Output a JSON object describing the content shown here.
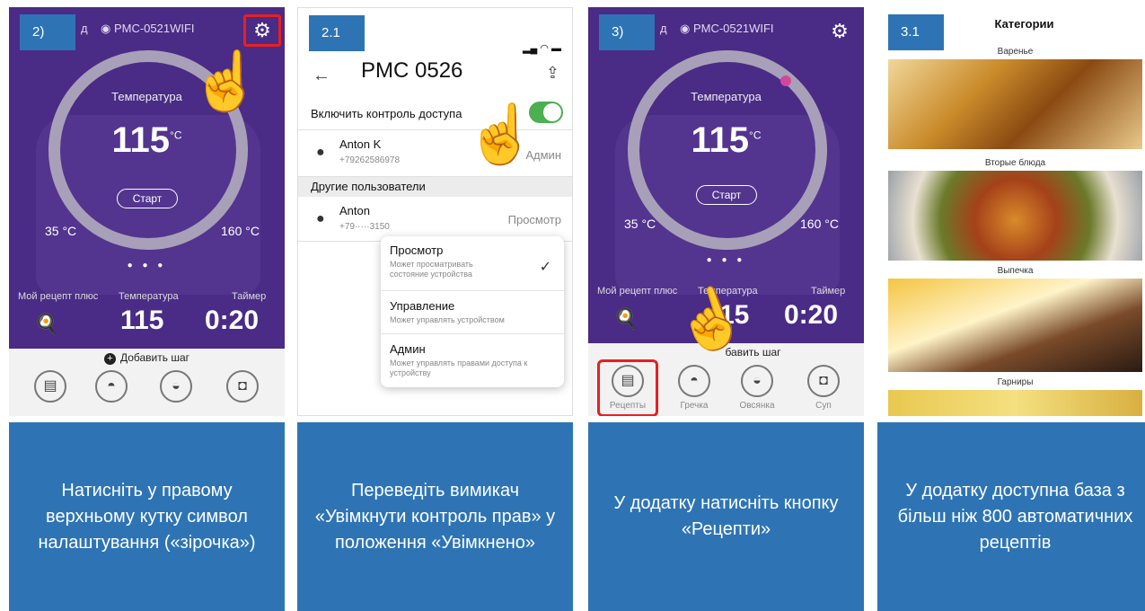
{
  "panels": [
    {
      "badge": "2)",
      "app": {
        "topbar_left": "д",
        "device": "◉ PMC-0521WIFI",
        "temp_label": "Температура",
        "temp_value": "115",
        "temp_unit": "°C",
        "start": "Старт",
        "min": "35 °C",
        "max": "160 °C",
        "stat1_label": "Мой рецепт плюс",
        "stat2_label": "Температура",
        "stat2_value": "115",
        "stat3_label": "Таймер",
        "stat3_value": "0:20",
        "add_step": "Добавить шаг"
      },
      "caption": "Натисніть у правому верхньому кутку символ налаштування («зірочка»)"
    },
    {
      "badge": "2.1",
      "settings": {
        "title": "PMC 0526",
        "access_label": "Включить контроль доступа",
        "owner_name": "Anton K",
        "owner_phone": "+79262586978",
        "owner_role": "Админ",
        "section": "Другие пользователи",
        "user_name": "Anton",
        "user_phone": "+79·····3150",
        "user_role": "Просмотр",
        "menu": [
          {
            "title": "Просмотр",
            "desc": "Может просматривать состояние устройства"
          },
          {
            "title": "Управление",
            "desc": "Может управлять устройством"
          },
          {
            "title": "Админ",
            "desc": "Может управлять правами доступа к устройству"
          }
        ]
      },
      "caption": "Переведіть вимикач «Увімкнути контроль прав» у положення «Увімкнено»"
    },
    {
      "badge": "3)",
      "app": {
        "topbar_left": "д",
        "device": "◉ PMC-0521WIFI",
        "temp_label": "Температура",
        "temp_value": "115",
        "temp_unit": "°C",
        "start": "Старт",
        "min": "35 °C",
        "max": "160 °C",
        "stat1_label": "Мой рецепт плюс",
        "stat2_label": "Температура",
        "stat2_value": "15",
        "stat3_label": "Таймер",
        "stat3_value": "0:20",
        "add_step": "бавить шаг",
        "tabs": [
          "Рецепты",
          "Гречка",
          "Овсянка",
          "Суп"
        ]
      },
      "caption": "У додатку натисніть кнопку «Рецепти»"
    },
    {
      "badge": "3.1",
      "categories": {
        "title": "Категории",
        "items": [
          "Варенье",
          "Вторые блюда",
          "Выпечка",
          "Гарниры"
        ]
      },
      "caption": "У додатку доступна база з більш ніж  800 автоматичних рецептів"
    }
  ]
}
